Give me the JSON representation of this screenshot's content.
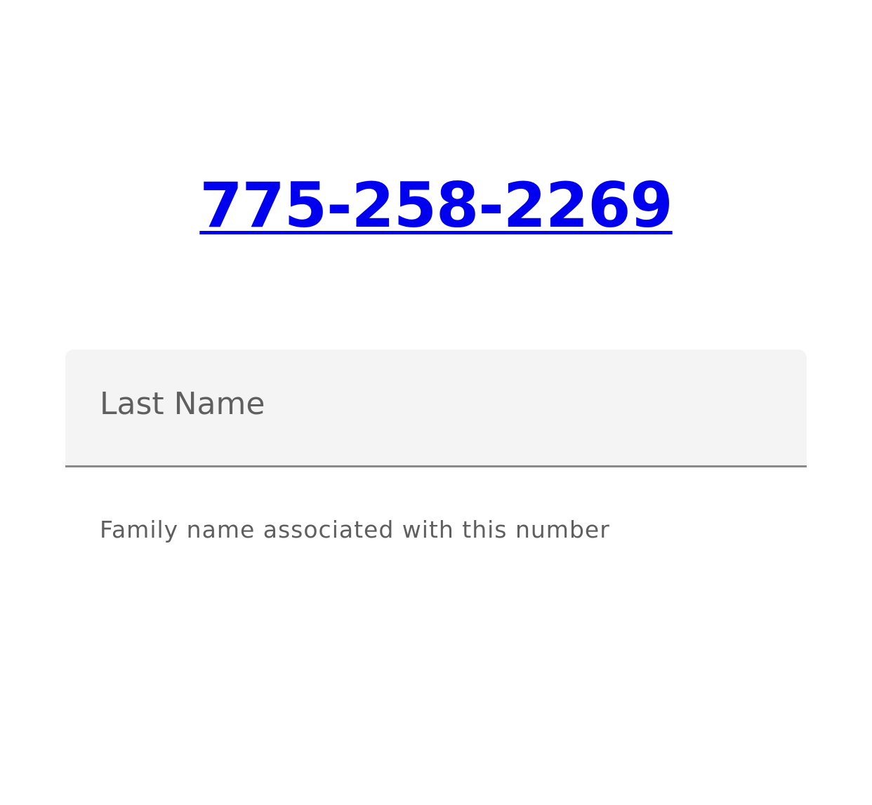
{
  "phone": {
    "number": "775-258-2269",
    "color": "#0000ee"
  },
  "last_name_field": {
    "label": "Last Name",
    "value": "",
    "helper_text": "Family name associated with this number",
    "background_color": "#f4f4f4",
    "underline_color": "#8a8a8a"
  }
}
